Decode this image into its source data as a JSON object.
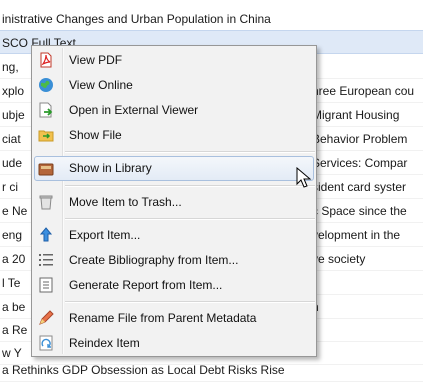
{
  "list": {
    "rows": [
      {
        "left": "inistrative Changes and Urban Population in China",
        "right": ""
      },
      {
        "left": "SCO Full Text",
        "right": ""
      },
      {
        "left": "ng,",
        "right": ""
      },
      {
        "left": "xplo",
        "right": "hree European cou"
      },
      {
        "left": "ubje",
        "right": "Migrant Housing"
      },
      {
        "left": "ciat",
        "right": "Behavior Problem"
      },
      {
        "left": "ude",
        "right": "Services: Compar"
      },
      {
        "left": "r ci",
        "right": "sident card syster"
      },
      {
        "left": "e Ne",
        "right": "c Space since the"
      },
      {
        "left": "eng",
        "right": "velopment in the"
      },
      {
        "left": "a 20",
        "right": "ve society"
      },
      {
        "left": "l Te",
        "right": ""
      },
      {
        "left": "a be",
        "right": "n"
      },
      {
        "left": "a Re",
        "right": ""
      },
      {
        "left": "w Y",
        "right": ""
      },
      {
        "left": "a Rethinks GDP Obsession as Local Debt Risks Rise",
        "right": ""
      }
    ]
  },
  "menu": {
    "items": [
      {
        "label": "View PDF",
        "icon": "pdf-icon"
      },
      {
        "label": "View Online",
        "icon": "globe-icon"
      },
      {
        "label": "Open in External Viewer",
        "icon": "external-viewer-icon"
      },
      {
        "label": "Show File",
        "icon": "show-file-icon"
      },
      {
        "label": "Show in Library",
        "icon": "library-icon"
      },
      {
        "label": "Move Item to Trash...",
        "icon": "trash-icon"
      },
      {
        "label": "Export Item...",
        "icon": "export-icon"
      },
      {
        "label": "Create Bibliography from Item...",
        "icon": "bibliography-icon"
      },
      {
        "label": "Generate Report from Item...",
        "icon": "report-icon"
      },
      {
        "label": "Rename File from Parent Metadata",
        "icon": "rename-icon"
      },
      {
        "label": "Reindex Item",
        "icon": "reindex-icon"
      }
    ]
  },
  "colors": {
    "selected_row": "#dfe9f7",
    "menu_bg": "#f2f2f2",
    "hover_border": "#a9c0de"
  }
}
